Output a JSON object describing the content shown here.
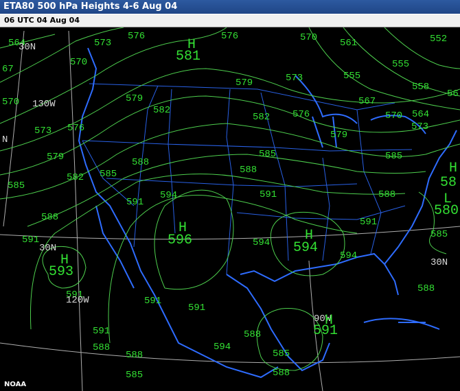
{
  "title": "ETA80 500 hPa Heights 4-6 Aug 04",
  "valid_time": "06 UTC 04 Aug 04",
  "credit": "NOAA",
  "colors": {
    "title_bg": "#2a569c",
    "subtitle_bg": "#f0f0f0",
    "map_bg": "#000000",
    "contour": "#4ed04e",
    "contour_label": "#33e033",
    "coast": "#2e6cff",
    "grid": "#cfcfcf"
  },
  "lat_lon_labels": [
    "30N",
    "130W",
    "N",
    "30N",
    "120W",
    "30N",
    "90W"
  ],
  "pressure_centers": [
    {
      "symbol": "H",
      "value": "581"
    },
    {
      "symbol": "H",
      "value": "596"
    },
    {
      "symbol": "H",
      "value": "594"
    },
    {
      "symbol": "H",
      "value": "593"
    },
    {
      "symbol": "H",
      "value": "591"
    },
    {
      "symbol": "H",
      "value": "58"
    },
    {
      "symbol": "L",
      "value": "580"
    }
  ],
  "contour_labels": [
    "564",
    "576",
    "573",
    "576",
    "570",
    "561",
    "552",
    "67",
    "570",
    "555",
    "555",
    "558",
    "56",
    "570",
    "579",
    "582",
    "573",
    "579",
    "576",
    "567",
    "564",
    "570",
    "573",
    "573",
    "576",
    "579",
    "582",
    "579",
    "588",
    "585",
    "588",
    "585",
    "582",
    "585",
    "585",
    "588",
    "591",
    "594",
    "591",
    "591",
    "588",
    "585",
    "591",
    "594",
    "594",
    "591",
    "588",
    "591",
    "591",
    "594",
    "588",
    "591",
    "585",
    "588",
    "588",
    "588",
    "585"
  ]
}
